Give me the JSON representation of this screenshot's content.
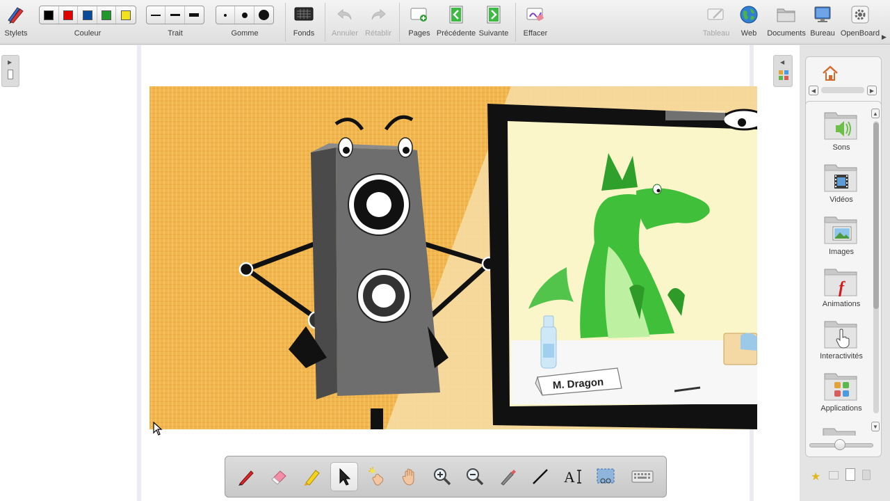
{
  "toolbar": {
    "stylets_label": "Stylets",
    "couleur_label": "Couleur",
    "trait_label": "Trait",
    "gomme_label": "Gomme",
    "fonds_label": "Fonds",
    "annuler_label": "Annuler",
    "retablir_label": "Rétablir",
    "pages_label": "Pages",
    "precedente_label": "Précédente",
    "suivante_label": "Suivante",
    "effacer_label": "Effacer",
    "tableau_label": "Tableau",
    "web_label": "Web",
    "documents_label": "Documents",
    "bureau_label": "Bureau",
    "openboard_label": "OpenBoard",
    "colors": [
      "#000000",
      "#e00000",
      "#0a4a9a",
      "#1f9a2a",
      "#f2e21c"
    ]
  },
  "scene": {
    "name_tag": "M. Dragon",
    "background_color": "#f2b54a",
    "dragon_color": "#3fbf3a"
  },
  "library": {
    "items": [
      {
        "label": "Sons",
        "icon": "speaker-icon"
      },
      {
        "label": "Vidéos",
        "icon": "film-icon"
      },
      {
        "label": "Images",
        "icon": "picture-icon"
      },
      {
        "label": "Animations",
        "icon": "flash-icon"
      },
      {
        "label": "Interactivités",
        "icon": "hand-pointer-icon"
      },
      {
        "label": "Applications",
        "icon": "apps-icon"
      }
    ]
  },
  "palette": {
    "tools": [
      "pen-icon",
      "eraser-icon",
      "marker-icon",
      "selector-icon",
      "laser-pointer-icon",
      "hand-icon",
      "zoom-in-icon",
      "zoom-out-icon",
      "capture-pen-icon",
      "line-icon",
      "text-icon",
      "capture-icon",
      "keyboard-icon"
    ],
    "active_tool": "selector-icon"
  }
}
